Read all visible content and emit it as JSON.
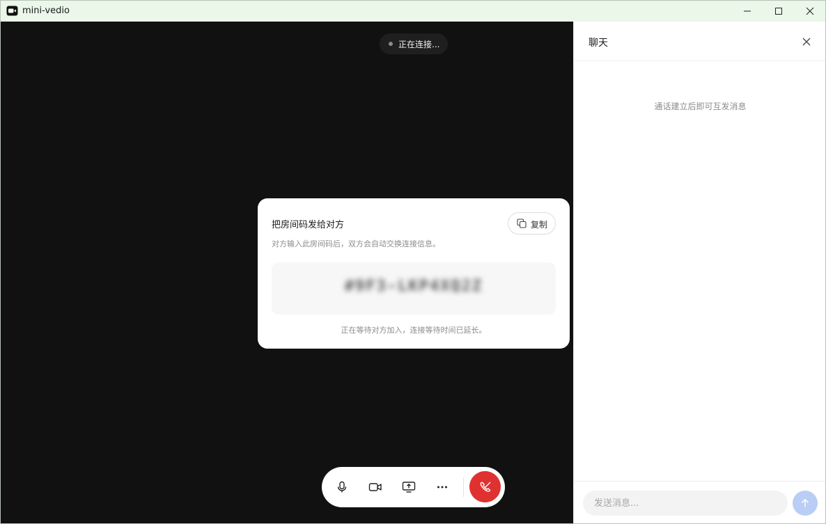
{
  "window": {
    "title": "mini-vedio",
    "icon": "video-camera-icon",
    "controls": [
      "minimize-icon",
      "maximize-icon",
      "close-icon"
    ]
  },
  "video": {
    "status": "正在连接..."
  },
  "room_card": {
    "title": "把房间码发给对方",
    "description": "对方输入此房间码后，双方会自动交换连接信息。",
    "copy_label": "复制",
    "copy_icon": "copy-icon",
    "code": "#9F3-LKP4XQ2Z",
    "waiting": "正在等待对方加入，连接等待时间已延长。"
  },
  "controls": {
    "items": [
      "microphone-icon",
      "camera-icon",
      "screen-share-icon",
      "more-icon"
    ],
    "hangup_icon": "hang-up-icon",
    "hangup_color": "#e03131"
  },
  "chat": {
    "title": "聊天",
    "empty_text": "通话建立后即可互发消息",
    "input_placeholder": "发送消息...",
    "send_icon": "arrow-up-icon",
    "send_color": "#b9cdf5"
  }
}
